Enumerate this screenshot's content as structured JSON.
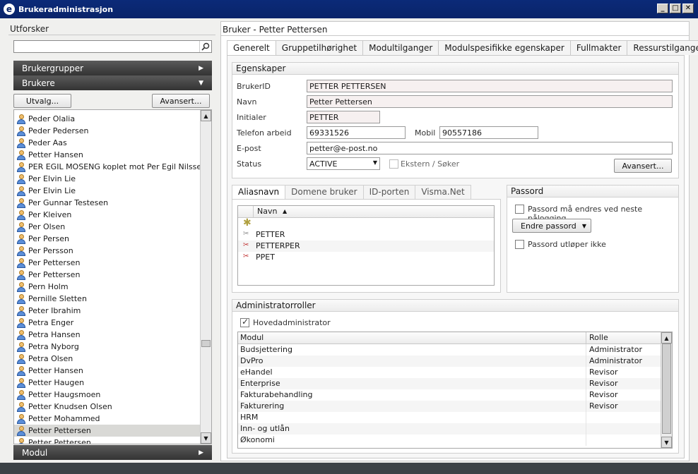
{
  "window": {
    "title": "Brukeradministrasjon",
    "buttons": [
      "_",
      "□",
      "✕"
    ]
  },
  "explorer": {
    "header": "Utforsker",
    "search": {
      "value": "",
      "placeholder": ""
    },
    "groups_bar": "Brukergrupper",
    "users_bar": "Brukere",
    "utvalg_button": "Utvalg...",
    "avansert_button": "Avansert...",
    "users": [
      "Peder Olalia",
      "Peder Pedersen",
      "Peder Aas",
      "Petter Hansen",
      "PER EGIL MOSENG koplet mot Per Egil Nilssen",
      "Per Elvin Lie",
      "Per Elvin Lie",
      "Per Gunnar Testesen",
      "Per Kleiven",
      "Per Olsen",
      "Per Persen",
      "Per Persson",
      "Per Pettersen",
      "Per Pettersen",
      "Pern Holm",
      "Pernille Sletten",
      "Peter Ibrahim",
      "Petra Enger",
      "Petra Hansen",
      "Petra Nyborg",
      "Petra Olsen",
      "Petter Hansen",
      "Petter Haugen",
      "Petter Haugsmoen",
      "Petter Knudsen Olsen",
      "Petter Mohammed",
      "Petter Pettersen",
      "Petter Pettersen"
    ],
    "selected_user_index": 26,
    "modul_bar": "Modul"
  },
  "detail": {
    "header": "Bruker - Petter Pettersen",
    "tabs": [
      "Generelt",
      "Gruppetilhørighet",
      "Modultilganger",
      "Modulspesifikke egenskaper",
      "Fullmakter",
      "Ressurstilganger"
    ],
    "active_tab": 0,
    "properties": {
      "title": "Egenskaper",
      "bruker_id_label": "BrukerID",
      "bruker_id": "PETTER PETTERSEN",
      "navn_label": "Navn",
      "navn": "Petter Pettersen",
      "initialer_label": "Initialer",
      "initialer": "PETTER",
      "telefon_label": "Telefon arbeid",
      "telefon": "69331526",
      "mobil_label": "Mobil",
      "mobil": "90557186",
      "epost_label": "E-post",
      "epost": "petter@e-post.no",
      "status_label": "Status",
      "status": "ACTIVE",
      "ekstern_label": "Ekstern / Søker",
      "ekstern_checked": false,
      "avansert_button": "Avansert..."
    },
    "alias": {
      "tabs": [
        "Aliasnavn",
        "Domene bruker",
        "ID-porten",
        "Visma.Net"
      ],
      "active_tab": 0,
      "column": "Navn",
      "new_row_icon": "asterisk-icon",
      "rows": [
        "PETTER",
        "PETTERPER",
        "PPET"
      ]
    },
    "password": {
      "title": "Passord",
      "must_change_label": "Passord må endres ved neste pålogging",
      "must_change": false,
      "change_button": "Endre passord",
      "never_expires_label": "Passord utløper ikke",
      "never_expires": false
    },
    "admin_roles": {
      "title": "Administratorroller",
      "main_admin_label": "Hovedadministrator",
      "main_admin": true,
      "columns": [
        "Modul",
        "Rolle"
      ],
      "rows": [
        {
          "modul": "Budsjettering",
          "rolle": "Administrator"
        },
        {
          "modul": "DvPro",
          "rolle": "Administrator"
        },
        {
          "modul": "eHandel",
          "rolle": "Revisor"
        },
        {
          "modul": "Enterprise",
          "rolle": "Revisor"
        },
        {
          "modul": "Fakturabehandling",
          "rolle": "Revisor"
        },
        {
          "modul": "Fakturering",
          "rolle": "Revisor"
        },
        {
          "modul": "HRM",
          "rolle": ""
        },
        {
          "modul": "Inn- og utlån",
          "rolle": ""
        },
        {
          "modul": "Økonomi",
          "rolle": ""
        }
      ]
    }
  }
}
